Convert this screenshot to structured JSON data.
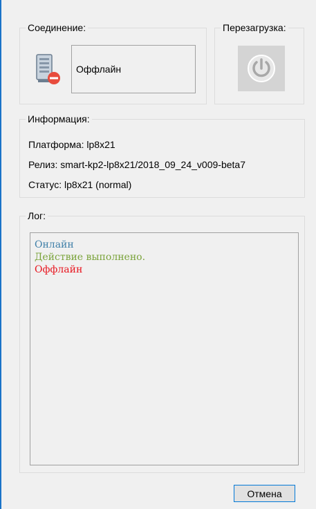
{
  "connection": {
    "title": "Соединение:",
    "status": "Оффлайн",
    "icon": "server-offline-icon"
  },
  "restart": {
    "title": "Перезагрузка:",
    "icon": "power-icon"
  },
  "info": {
    "title": "Информация:",
    "platform": "Платформа: lp8x21",
    "release": "Релиз: smart-kp2-lp8x21/2018_09_24_v009-beta7",
    "status": "Статус: lp8x21 (normal)"
  },
  "log": {
    "title": "Лог:",
    "lines": [
      {
        "text": "Онлайн",
        "color": "#3f7fa8"
      },
      {
        "text": "Действие выполнено.",
        "color": "#7aa33a"
      },
      {
        "text": "Оффлайн",
        "color": "#e8141e"
      }
    ]
  },
  "buttons": {
    "cancel": "Отмена"
  },
  "colors": {
    "accent": "#0078d7",
    "window_border": "#1a73c8"
  }
}
